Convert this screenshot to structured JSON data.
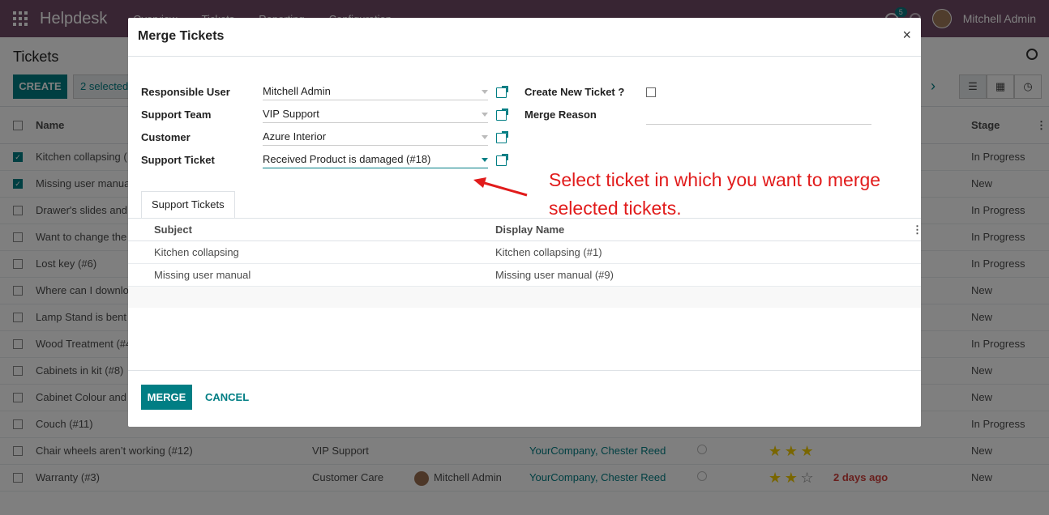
{
  "topbar": {
    "app_name": "Helpdesk",
    "menu": [
      "Overview",
      "Tickets",
      "Reporting",
      "Configuration"
    ],
    "chat_count": "5",
    "user_name": "Mitchell Admin"
  },
  "control_panel": {
    "breadcrumb": "Tickets",
    "create_label": "CREATE",
    "selected_label": "2 selected"
  },
  "list": {
    "columns": {
      "name": "Name",
      "stage": "Stage"
    },
    "rows": [
      {
        "name": "Kitchen collapsing (",
        "team": "",
        "assignee": "",
        "customer": "",
        "rating": 0,
        "deadline": "",
        "stage": "In Progress",
        "checked": true
      },
      {
        "name": "Missing user manua",
        "team": "",
        "assignee": "",
        "customer": "",
        "rating": 0,
        "deadline": "",
        "stage": "New",
        "checked": true
      },
      {
        "name": "Drawer's slides and",
        "team": "",
        "assignee": "",
        "customer": "",
        "rating": 0,
        "deadline": "",
        "stage": "In Progress",
        "checked": false
      },
      {
        "name": "Want to change the",
        "team": "",
        "assignee": "",
        "customer": "",
        "rating": 0,
        "deadline": "",
        "stage": "In Progress",
        "checked": false
      },
      {
        "name": "Lost key (#6)",
        "team": "",
        "assignee": "",
        "customer": "",
        "rating": 0,
        "deadline": "",
        "stage": "In Progress",
        "checked": false
      },
      {
        "name": "Where can I downlo",
        "team": "",
        "assignee": "",
        "customer": "",
        "rating": 0,
        "deadline": "",
        "stage": "New",
        "checked": false
      },
      {
        "name": "Lamp Stand is bent",
        "team": "",
        "assignee": "",
        "customer": "",
        "rating": 0,
        "deadline": "",
        "stage": "New",
        "checked": false
      },
      {
        "name": "Wood Treatment (#4",
        "team": "",
        "assignee": "",
        "customer": "",
        "rating": 0,
        "deadline": "",
        "stage": "In Progress",
        "checked": false
      },
      {
        "name": "Cabinets in kit (#8)",
        "team": "",
        "assignee": "",
        "customer": "",
        "rating": 0,
        "deadline": "",
        "stage": "New",
        "checked": false
      },
      {
        "name": "Cabinet Colour and",
        "team": "",
        "assignee": "",
        "customer": "",
        "rating": 0,
        "deadline": "",
        "stage": "New",
        "checked": false
      },
      {
        "name": "Couch (#11)",
        "team": "",
        "assignee": "",
        "customer": "",
        "rating": 0,
        "deadline": "",
        "stage": "In Progress",
        "checked": false
      },
      {
        "name": "Chair wheels aren’t working (#12)",
        "team": "VIP Support",
        "assignee": "",
        "customer": "YourCompany, Chester Reed",
        "rating": 3,
        "deadline": "",
        "stage": "New",
        "checked": false
      },
      {
        "name": "Warranty (#3)",
        "team": "Customer Care",
        "assignee": "Mitchell Admin",
        "customer": "YourCompany, Chester Reed",
        "rating": 2,
        "deadline": "2 days ago",
        "stage": "New",
        "checked": false
      }
    ]
  },
  "dialog": {
    "title": "Merge Tickets",
    "labels": {
      "responsible_user": "Responsible User",
      "support_team": "Support Team",
      "customer": "Customer",
      "support_ticket": "Support Ticket",
      "create_new_ticket": "Create New Ticket ?",
      "merge_reason": "Merge Reason"
    },
    "values": {
      "responsible_user": "Mitchell Admin",
      "support_team": "VIP Support",
      "customer": "Azure Interior",
      "support_ticket": "Received Product is damaged (#18)",
      "merge_reason": ""
    },
    "tab_label": "Support Tickets",
    "sub_columns": {
      "subject": "Subject",
      "display_name": "Display Name"
    },
    "sub_rows": [
      {
        "subject": "Kitchen collapsing",
        "display_name": "Kitchen collapsing (#1)"
      },
      {
        "subject": "Missing user manual",
        "display_name": "Missing user manual (#9)"
      }
    ],
    "merge_label": "MERGE",
    "cancel_label": "CANCEL"
  },
  "annotation": {
    "text": "Select ticket in which you want to merge selected tickets."
  },
  "colors": {
    "brand": "#714B67",
    "accent": "#017e84",
    "annotation": "#e11b1b"
  }
}
